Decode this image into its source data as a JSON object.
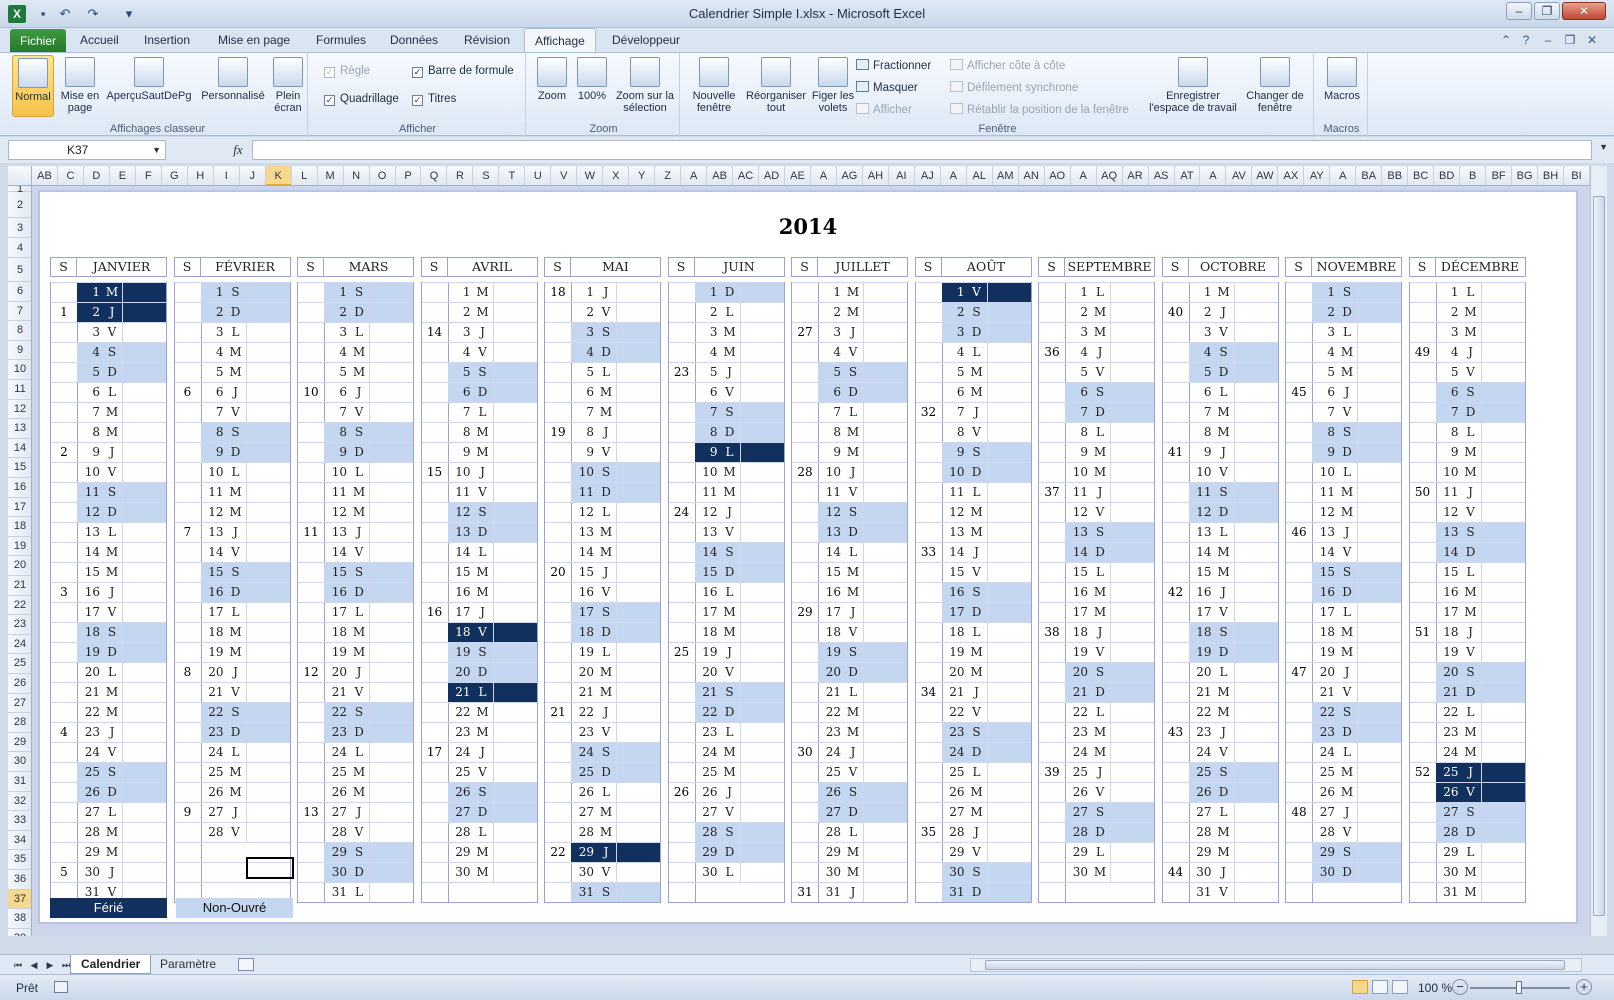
{
  "window": {
    "title": "Calendrier Simple I.xlsx  -  Microsoft Excel",
    "app_icon": "X"
  },
  "ribbon_tabs": [
    "Fichier",
    "Accueil",
    "Insertion",
    "Mise en page",
    "Formules",
    "Données",
    "Révision",
    "Affichage",
    "Développeur"
  ],
  "ribbon": {
    "affichages": {
      "label": "Affichages classeur",
      "buttons": [
        "Normal",
        "Mise en page",
        "AperçuSautDePg",
        "Personnalisé",
        "Plein écran"
      ]
    },
    "afficher": {
      "label": "Afficher",
      "regle": "Règle",
      "quadrillage": "Quadrillage",
      "barre_formule": "Barre de formule",
      "titres": "Titres"
    },
    "zoom": {
      "label": "Zoom",
      "buttons": [
        "Zoom",
        "100%",
        "Zoom sur la sélection"
      ]
    },
    "fenetre": {
      "label": "Fenêtre",
      "buttons": [
        "Nouvelle fenêtre",
        "Réorganiser tout",
        "Figer les volets"
      ],
      "fractionner": "Fractionner",
      "masquer": "Masquer",
      "afficher": "Afficher",
      "cote_a_cote": "Afficher côte à côte",
      "defilement": "Défilement synchrone",
      "retablir": "Rétablir la position de la fenêtre",
      "enregistrer": "Enregistrer l'espace de travail",
      "changer": "Changer de fenêtre"
    },
    "macros": {
      "label": "Macros",
      "button": "Macros"
    }
  },
  "formula_bar": {
    "name_box": "K37",
    "fx": "fx",
    "content": ""
  },
  "column_headers": [
    "AB",
    "C",
    "D",
    "E",
    "F",
    "G",
    "H",
    "I",
    "J",
    "K",
    "L",
    "M",
    "N",
    "O",
    "P",
    "Q",
    "R",
    "S",
    "T",
    "U",
    "V",
    "W",
    "X",
    "Y",
    "Z",
    "A",
    "AB",
    "AC",
    "AD",
    "AE",
    "A",
    "AG",
    "AH",
    "AI",
    "AJ",
    "A",
    "AL",
    "AM",
    "AN",
    "AO",
    "A",
    "AQ",
    "AR",
    "AS",
    "AT",
    "A",
    "AV",
    "AW",
    "AX",
    "AY",
    "A",
    "BA",
    "BB",
    "BC",
    "BD",
    "B",
    "BF",
    "BG",
    "BH",
    "BI"
  ],
  "row_headers": [
    "1",
    "2",
    "3",
    "4",
    "5",
    "6",
    "7",
    "8",
    "9",
    "10",
    "11",
    "12",
    "13",
    "14",
    "15",
    "16",
    "17",
    "18",
    "19",
    "20",
    "21",
    "22",
    "23",
    "24",
    "25",
    "26",
    "27",
    "28",
    "29",
    "30",
    "31",
    "32",
    "33",
    "34",
    "35",
    "36",
    "37",
    "38",
    "39",
    "40"
  ],
  "calendar": {
    "year": "2014",
    "week_header": "S",
    "months": [
      {
        "name": "JANVIER",
        "first_weekday": 2,
        "days": 31,
        "week_start": 1
      },
      {
        "name": "FÉVRIER",
        "first_weekday": 5,
        "days": 28,
        "week_start": 5
      },
      {
        "name": "MARS",
        "first_weekday": 5,
        "days": 31,
        "week_start": 9
      },
      {
        "name": "AVRIL",
        "first_weekday": 1,
        "days": 30,
        "week_start": 14
      },
      {
        "name": "MAI",
        "first_weekday": 3,
        "days": 31,
        "week_start": 18
      },
      {
        "name": "JUIN",
        "first_weekday": 6,
        "days": 30,
        "week_start": 22
      },
      {
        "name": "JUILLET",
        "first_weekday": 1,
        "days": 31,
        "week_start": 27
      },
      {
        "name": "AOÛT",
        "first_weekday": 4,
        "days": 31,
        "week_start": 31
      },
      {
        "name": "SEPTEMBRE",
        "first_weekday": 0,
        "days": 30,
        "week_start": 36
      },
      {
        "name": "OCTOBRE",
        "first_weekday": 2,
        "days": 31,
        "week_start": 40
      },
      {
        "name": "NOVEMBRE",
        "first_weekday": 5,
        "days": 30,
        "week_start": 44
      },
      {
        "name": "DÉCEMBRE",
        "first_weekday": 0,
        "days": 31,
        "week_start": 49
      }
    ],
    "day_letters": [
      "L",
      "M",
      "M",
      "J",
      "V",
      "S",
      "D"
    ],
    "holidays": {
      "JANVIER": [
        1,
        2
      ],
      "AVRIL": [
        18,
        21
      ],
      "MAI": [
        29
      ],
      "JUIN": [
        9
      ],
      "AOÛT": [
        1
      ],
      "DÉCEMBRE": [
        25,
        26
      ]
    },
    "legend": {
      "ferie": "Férié",
      "non_ouvre": "Non-Ouvré"
    },
    "colors": {
      "holiday": "#12305e",
      "weekend": "#c5d6f0"
    }
  },
  "sheet_tabs": [
    "Calendrier",
    "Paramètre"
  ],
  "status": {
    "ready": "Prêt",
    "zoom": "100 %"
  }
}
